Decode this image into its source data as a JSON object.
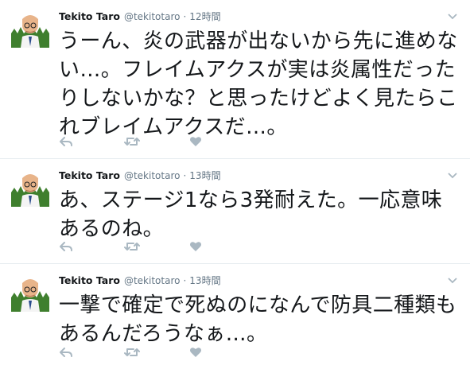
{
  "tweets": [
    {
      "name": "Tekito Taro",
      "handle": "@tekitotaro",
      "separator": "·",
      "time": "12時間",
      "text": "うーん、炎の武器が出ないから先に進めない…。フレイムアクスが実は炎属性だったりしないかな？と思ったけどよく見たらこれブレイムアクスだ…。"
    },
    {
      "name": "Tekito Taro",
      "handle": "@tekitotaro",
      "separator": "·",
      "time": "13時間",
      "text": "あ、ステージ1なら3発耐えた。一応意味あるのね。"
    },
    {
      "name": "Tekito Taro",
      "handle": "@tekitotaro",
      "separator": "·",
      "time": "13時間",
      "text": "一撃で確定で死ぬのになんで防具二種類もあるんだろうなぁ…。"
    }
  ],
  "icons": {
    "reply": "reply-icon",
    "retweet": "retweet-icon",
    "like": "heart-icon",
    "more": "chevron-down-icon"
  },
  "colors": {
    "icon_gray": "#aab8c2",
    "text_gray": "#657786",
    "divider": "#e6ecf0"
  }
}
